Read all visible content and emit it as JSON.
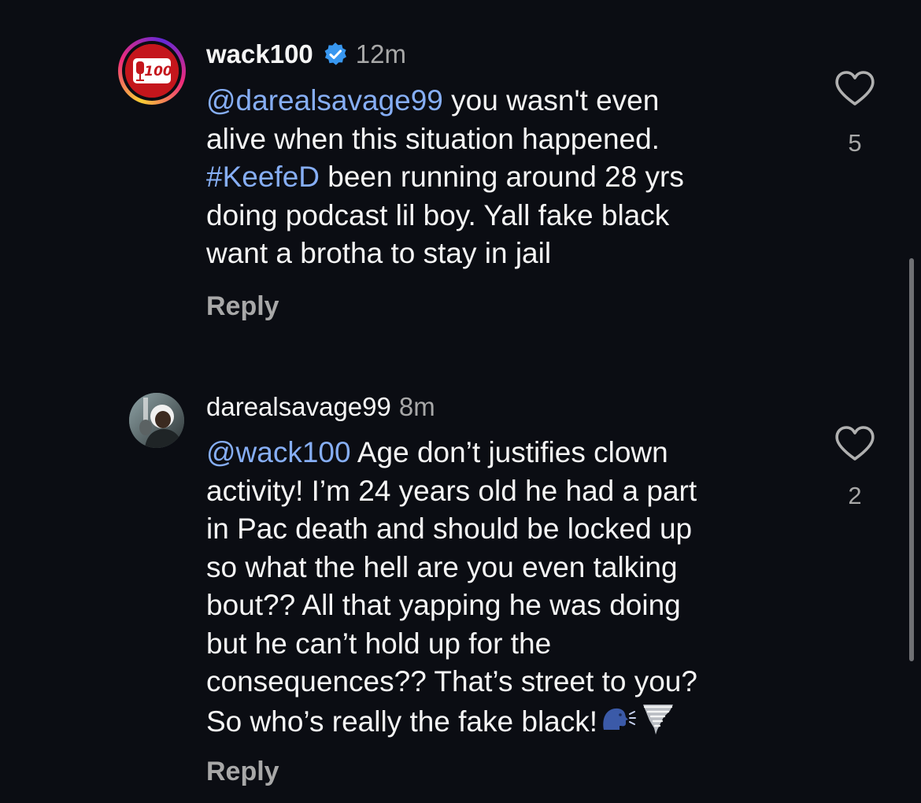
{
  "comments": [
    {
      "username": "wack100",
      "verified": true,
      "time": "12m",
      "lines": [
        {
          "mention": "@darealsavage99",
          "text": " you wasn't even"
        },
        {
          "text": "alive when this situation happened."
        },
        {
          "hashtag": "#KeefeD",
          "text": " been running around 28 yrs"
        },
        {
          "text": "doing podcast lil boy. Yall fake black"
        },
        {
          "text": "want a brotha to stay in jail"
        }
      ],
      "reply_label": "Reply",
      "likes": "5",
      "avatar_logo_text": "100"
    },
    {
      "username": "darealsavage99",
      "verified": false,
      "time": "8m",
      "lines": [
        {
          "mention": "@wack100",
          "text": " Age don’t justifies clown"
        },
        {
          "text": "activity! I’m 24 years old he had a part"
        },
        {
          "text": "in Pac death and should be locked up"
        },
        {
          "text": "so what the hell are you even talking"
        },
        {
          "text": "bout?? All that yapping he was doing"
        },
        {
          "text": "but he can’t hold up for the"
        },
        {
          "text": "consequences?? That’s street to you?"
        },
        {
          "text": "So who’s really the fake black!"
        }
      ],
      "trailing_emoji": [
        "speaking-head-emoji",
        "tornado-emoji"
      ],
      "reply_label": "Reply",
      "likes": "2"
    }
  ],
  "colors": {
    "background": "#0b0d13",
    "text": "#f5f5f5",
    "secondary": "#a8a8a8",
    "link": "#86aef5",
    "verified": "#3897f0",
    "avatar_brand": "#c4161c"
  }
}
